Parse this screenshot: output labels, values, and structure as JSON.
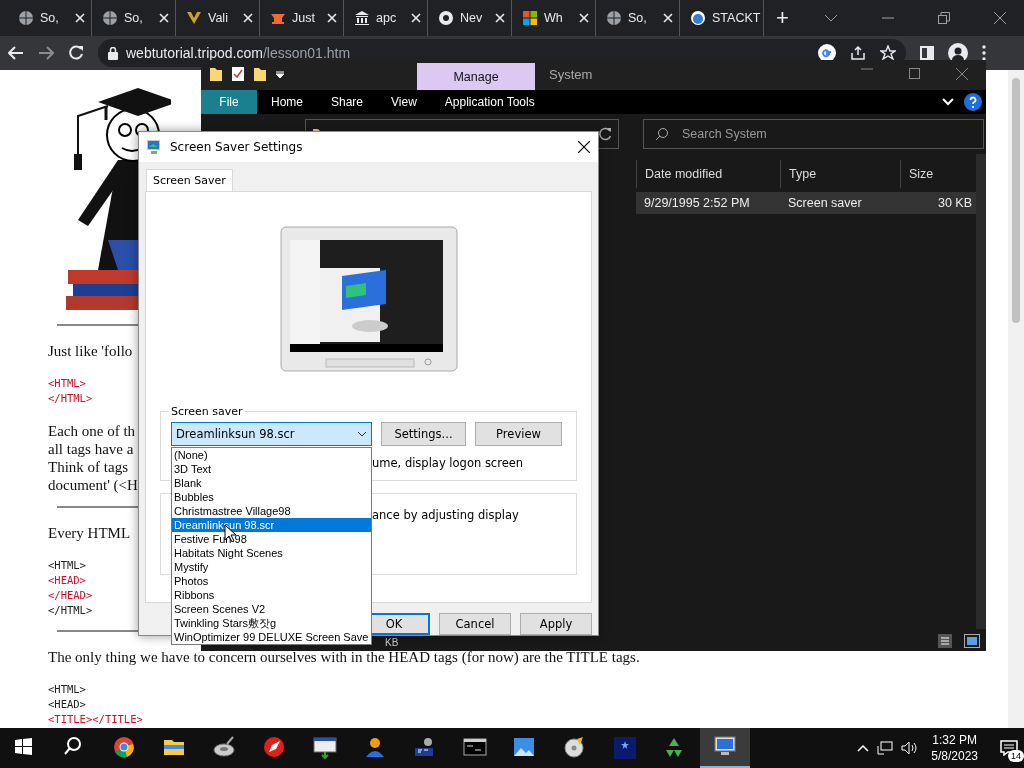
{
  "browser": {
    "tabs": [
      {
        "label": "So,",
        "kind": "globe",
        "selected": false
      },
      {
        "label": "So,",
        "kind": "globe",
        "selected": false
      },
      {
        "label": "Vali",
        "kind": "v",
        "selected": false
      },
      {
        "label": "Just",
        "kind": "anvil",
        "selected": false
      },
      {
        "label": "apc",
        "kind": "bank",
        "selected": false
      },
      {
        "label": "Nev",
        "kind": "chrome",
        "selected": false
      },
      {
        "label": "Wh",
        "kind": "windows",
        "selected": false
      },
      {
        "label": "So,",
        "kind": "globe",
        "selected": false
      },
      {
        "label": "STACKT",
        "kind": "circle",
        "selected": false
      }
    ],
    "new_tab": "+",
    "address": {
      "host": "webtutorial.tripod.com",
      "path": "/lesson01.htm"
    }
  },
  "webpage": {
    "blocks": [
      {
        "kind": "image"
      },
      {
        "kind": "rule"
      },
      {
        "kind": "text",
        "text": "Just like 'follo"
      },
      {
        "kind": "code",
        "lines": [
          {
            "text": "<HTML>",
            "highlighted": true
          },
          {
            "text": "</HTML>",
            "highlighted": true
          }
        ]
      },
      {
        "kind": "para",
        "lines": [
          "Each one of th",
          "all tags have a",
          "Think of tags",
          "document' (<H"
        ]
      },
      {
        "kind": "rule"
      },
      {
        "kind": "text",
        "text": "Every HTML"
      },
      {
        "kind": "code",
        "lines": [
          {
            "text": "<HTML>",
            "highlighted": false
          },
          {
            "text": "<HEAD>",
            "highlighted": true
          },
          {
            "text": "</HEAD>",
            "highlighted": true
          },
          {
            "text": "</HTML>",
            "highlighted": false
          }
        ]
      },
      {
        "kind": "rule"
      },
      {
        "kind": "text",
        "text": "The only thing we have to concern ourselves with in the HEAD tags (for now) are the TITLE tags."
      },
      {
        "kind": "code",
        "lines": [
          {
            "text": "<HTML>",
            "highlighted": false
          },
          {
            "text": "<HEAD>",
            "highlighted": false
          },
          {
            "text": "<TITLE></TITLE>",
            "highlighted": true
          }
        ]
      }
    ]
  },
  "explorer": {
    "context_tab": "Manage",
    "title": "System",
    "ribbon_tabs": [
      {
        "label": "File",
        "kind": "file"
      },
      {
        "label": "Home",
        "kind": "tab"
      },
      {
        "label": "Share",
        "kind": "tab"
      },
      {
        "label": "View",
        "kind": "tab"
      },
      {
        "label": "Application Tools",
        "kind": "tab"
      }
    ],
    "search": {
      "placeholder": "Search System"
    },
    "columns": [
      "Date modified",
      "Type",
      "Size"
    ],
    "rows": [
      {
        "cells": [
          "9/29/1995 2:52 PM",
          "Screen saver",
          "30 KB"
        ],
        "selected": true
      }
    ],
    "status_bar": "KB"
  },
  "dialog": {
    "title": "Screen Saver Settings",
    "tabs": [
      {
        "label": "Screen Saver",
        "selected": true
      }
    ],
    "group_label": "Screen saver",
    "combo_value": "Dreamlinksun 98.scr",
    "group_buttons": [
      "Settings...",
      "Preview"
    ],
    "checkbox_text": "ume, display logon screen",
    "power_text": "ance by adjusting display",
    "footer_buttons": [
      {
        "label": "OK",
        "default": true
      },
      {
        "label": "Cancel",
        "default": false
      },
      {
        "label": "Apply",
        "default": false
      }
    ],
    "dropdown": [
      {
        "label": "(None)",
        "selected": false
      },
      {
        "label": "3D Text",
        "selected": false
      },
      {
        "label": "Blank",
        "selected": false
      },
      {
        "label": "Bubbles",
        "selected": false
      },
      {
        "label": "Christmastree Village98",
        "selected": false
      },
      {
        "label": "Dreamlinksun 98.scr",
        "selected": true
      },
      {
        "label": "Festive Fun 98",
        "selected": false
      },
      {
        "label": "Habitats Night Scenes",
        "selected": false
      },
      {
        "label": "Mystify",
        "selected": false
      },
      {
        "label": "Photos",
        "selected": false
      },
      {
        "label": "Ribbons",
        "selected": false
      },
      {
        "label": "Screen Scenes V2",
        "selected": false
      },
      {
        "label": "Twinkling Stars敷잣g",
        "selected": false
      },
      {
        "label": "WinOptimizer 99  DELUXE Screen Save",
        "selected": false
      }
    ]
  },
  "taskbar": {
    "apps": [
      {
        "kind": "start",
        "active": false
      },
      {
        "kind": "search",
        "active": false
      },
      {
        "kind": "chrome",
        "active": false
      },
      {
        "kind": "folder",
        "active": false
      },
      {
        "kind": "disc",
        "active": false
      },
      {
        "kind": "rocket",
        "active": false
      },
      {
        "kind": "batch",
        "active": false
      },
      {
        "kind": "person",
        "active": false
      },
      {
        "kind": "ftp",
        "active": false
      },
      {
        "kind": "terminal",
        "active": false
      },
      {
        "kind": "photo",
        "active": false
      },
      {
        "kind": "cd",
        "active": false
      },
      {
        "kind": "stars",
        "active": false
      },
      {
        "kind": "recycle",
        "active": false
      },
      {
        "kind": "monitor",
        "active": true
      }
    ],
    "time": "1:32 PM",
    "date": "5/8/2023",
    "notifications": "14"
  }
}
